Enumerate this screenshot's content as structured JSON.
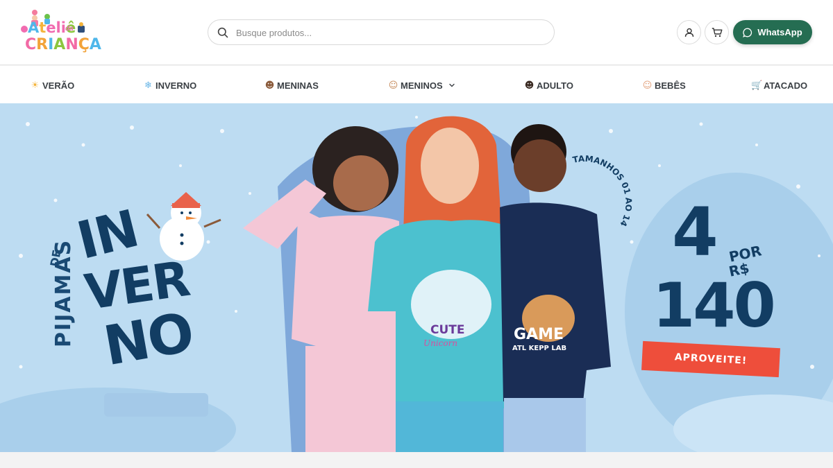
{
  "brand": {
    "name_line1_a": "A",
    "name_line1_rest_t": "t",
    "name_line1_rest_el": "eli",
    "name_line1_e": "ê",
    "name_small": "da",
    "name_line2": [
      "C",
      "R",
      "I",
      "A",
      "N",
      "Ç",
      "A"
    ]
  },
  "search": {
    "placeholder": "Busque produtos..."
  },
  "header": {
    "whatsapp_label": "WhatsApp"
  },
  "nav": {
    "items": [
      {
        "emoji": "☀",
        "label": "VERÃO"
      },
      {
        "emoji": "❄",
        "label": "INVERNO"
      },
      {
        "emoji": "☻",
        "label": "MENINAS"
      },
      {
        "emoji": "☺",
        "label": "MENINOS"
      },
      {
        "emoji": "☻",
        "label": "ADULTO"
      },
      {
        "emoji": "☺",
        "label": "BEBÊS"
      },
      {
        "emoji": "🛒",
        "label": "ATACADO"
      }
    ]
  },
  "hero": {
    "title_small": "PIJAMAS",
    "title_de": "DE",
    "title_lines": [
      "IN",
      "VER",
      "NO"
    ],
    "sizes_text": "TAMANHOS 01 AO 14",
    "promo_qty": "4",
    "promo_por": "POR",
    "promo_currency": "R$",
    "promo_price": "140",
    "cta_label": "APROVEITE!",
    "shirt_texts": [
      "CUTE",
      "Unicorn",
      "GAME",
      "ATL KEPP LAB"
    ]
  },
  "colors": {
    "accent_whatsapp": "#256d52",
    "hero_bg": "#bddcf2",
    "hero_text": "#123d63",
    "cta": "#ee4e3b"
  }
}
